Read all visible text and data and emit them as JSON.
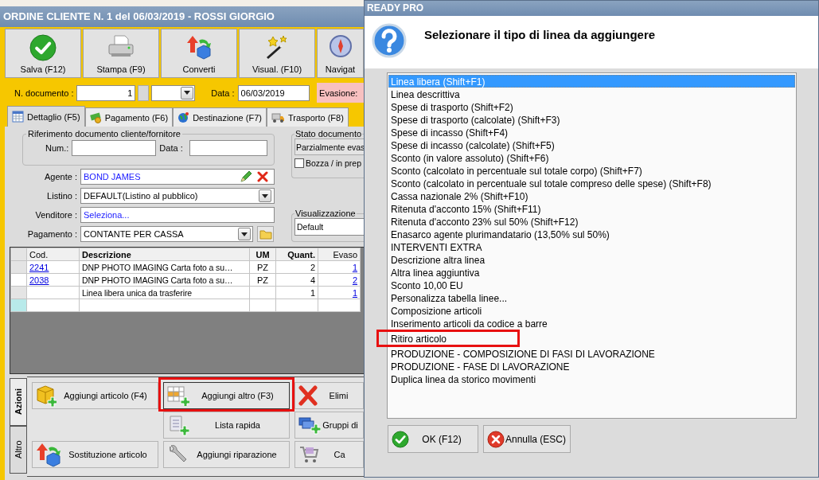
{
  "window": {
    "title": "ORDINE CLIENTE N. 1 del 06/03/2019 - ROSSI GIORGIO"
  },
  "toolbar": [
    {
      "label": "Salva (F12)"
    },
    {
      "label": "Stampa (F9)"
    },
    {
      "label": "Converti"
    },
    {
      "label": "Visual. (F10)"
    },
    {
      "label": "Navigat"
    }
  ],
  "header": {
    "doc_number_label": "N. documento :",
    "doc_number": "1",
    "date_label": "Data :",
    "date": "06/03/2019",
    "evasione_label": "Evasione:"
  },
  "tabs": [
    {
      "label": "Dettaglio (F5)",
      "selected": true
    },
    {
      "label": "Pagamento (F6)",
      "selected": false
    },
    {
      "label": "Destinazione (F7)",
      "selected": false
    },
    {
      "label": "Trasporto (F8)",
      "selected": false
    }
  ],
  "reference": {
    "title": "Riferimento documento cliente/fornitore",
    "num_label": "Num.:",
    "date_label": "Data :"
  },
  "fields": [
    {
      "label": "Agente :",
      "value": "BOND JAMES",
      "kind": "agent"
    },
    {
      "label": "Listino :",
      "value": "DEFAULT(Listino al pubblico)",
      "kind": "select"
    },
    {
      "label": "Venditore :",
      "value": "Seleziona...",
      "kind": "picker"
    },
    {
      "label": "Pagamento :",
      "value": "CONTANTE PER CASSA",
      "kind": "payment"
    }
  ],
  "status_group": {
    "title": "Stato documento",
    "value": "Parzialmente evas",
    "draft_label": "Bozza / in prep",
    "draft_checked": false
  },
  "view_group": {
    "title": "Visualizzazione",
    "value": "Default"
  },
  "table": {
    "columns": [
      "Cod.",
      "Descrizione",
      "UM",
      "Quant.",
      "Evaso"
    ],
    "rows": [
      {
        "code": "2241",
        "description": "DNP PHOTO IMAGING Carta foto a su…",
        "um": "PZ",
        "quantity": "2",
        "shipped": "1",
        "current": false
      },
      {
        "code": "2038",
        "description": "DNP PHOTO IMAGING Carta foto a su…",
        "um": "PZ",
        "quantity": "4",
        "shipped": "2",
        "current": true
      },
      {
        "description": "Linea libera unica da trasferire",
        "quantity": "1",
        "shipped": "1",
        "current": false
      }
    ],
    "new_row": true
  },
  "actions": {
    "tabs": [
      {
        "label": "Azioni",
        "selected": true
      },
      {
        "label": "Altro",
        "selected": false
      }
    ],
    "buttons": [
      {
        "label": "Aggiungi articolo (F4)",
        "highlighted": false
      },
      {
        "label": "Aggiungi altro (F3)",
        "highlighted": true
      },
      {
        "label": "Elimi",
        "highlighted": false
      },
      {
        "label": "Lista rapida",
        "highlighted": false
      },
      {
        "label": "Gruppi di",
        "highlighted": false
      },
      {
        "label": "Sostituzione articolo",
        "highlighted": false
      },
      {
        "label": "Aggiungi riparazione",
        "highlighted": false
      },
      {
        "label": "Ca",
        "highlighted": false
      }
    ]
  },
  "dialog": {
    "title": "READY PRO",
    "message": "Selezionare il tipo di linea da aggiungere",
    "items": [
      {
        "label": "Linea libera (Shift+F1)",
        "selected": true,
        "highlighted": false
      },
      {
        "label": "Linea descrittiva",
        "selected": false,
        "highlighted": false
      },
      {
        "label": "Spese di trasporto (Shift+F2)",
        "selected": false,
        "highlighted": false
      },
      {
        "label": "Spese di trasporto (calcolate) (Shift+F3)",
        "selected": false,
        "highlighted": false
      },
      {
        "label": "Spese di incasso (Shift+F4)",
        "selected": false,
        "highlighted": false
      },
      {
        "label": "Spese di incasso (calcolate) (Shift+F5)",
        "selected": false,
        "highlighted": false
      },
      {
        "label": "Sconto (in valore assoluto) (Shift+F6)",
        "selected": false,
        "highlighted": false
      },
      {
        "label": "Sconto (calcolato in percentuale sul totale corpo) (Shift+F7)",
        "selected": false,
        "highlighted": false
      },
      {
        "label": "Sconto (calcolato in percentuale sul totale compreso delle spese) (Shift+F8)",
        "selected": false,
        "highlighted": false
      },
      {
        "label": "Cassa nazionale 2% (Shift+F10)",
        "selected": false,
        "highlighted": false
      },
      {
        "label": "Ritenuta d'acconto 15% (Shift+F11)",
        "selected": false,
        "highlighted": false
      },
      {
        "label": "Ritenuta d'acconto 23% sul 50% (Shift+F12)",
        "selected": false,
        "highlighted": false
      },
      {
        "label": "Enasarco agente plurimandatario (13,50% sul 50%)",
        "selected": false,
        "highlighted": false
      },
      {
        "label": "INTERVENTI EXTRA",
        "selected": false,
        "highlighted": false
      },
      {
        "label": "Descrizione altra linea",
        "selected": false,
        "highlighted": false
      },
      {
        "label": "Altra linea aggiuntiva",
        "selected": false,
        "highlighted": false
      },
      {
        "label": "Sconto 10,00 EU",
        "selected": false,
        "highlighted": false
      },
      {
        "label": "Personalizza tabella linee...",
        "selected": false,
        "highlighted": false
      },
      {
        "label": "Composizione articoli",
        "selected": false,
        "highlighted": false
      },
      {
        "label": "Inserimento articoli da codice a barre",
        "selected": false,
        "highlighted": false
      },
      {
        "label": "Ritiro articolo",
        "selected": false,
        "highlighted": true
      },
      {
        "label": "PRODUZIONE - COMPOSIZIONE DI FASI DI LAVORAZIONE",
        "selected": false,
        "highlighted": false
      },
      {
        "label": "PRODUZIONE - FASE DI LAVORAZIONE",
        "selected": false,
        "highlighted": false
      },
      {
        "label": "Duplica linea da storico movimenti",
        "selected": false,
        "highlighted": false
      }
    ],
    "buttons": [
      {
        "label": "OK (F12)"
      },
      {
        "label": "Annulla (ESC)"
      }
    ]
  }
}
